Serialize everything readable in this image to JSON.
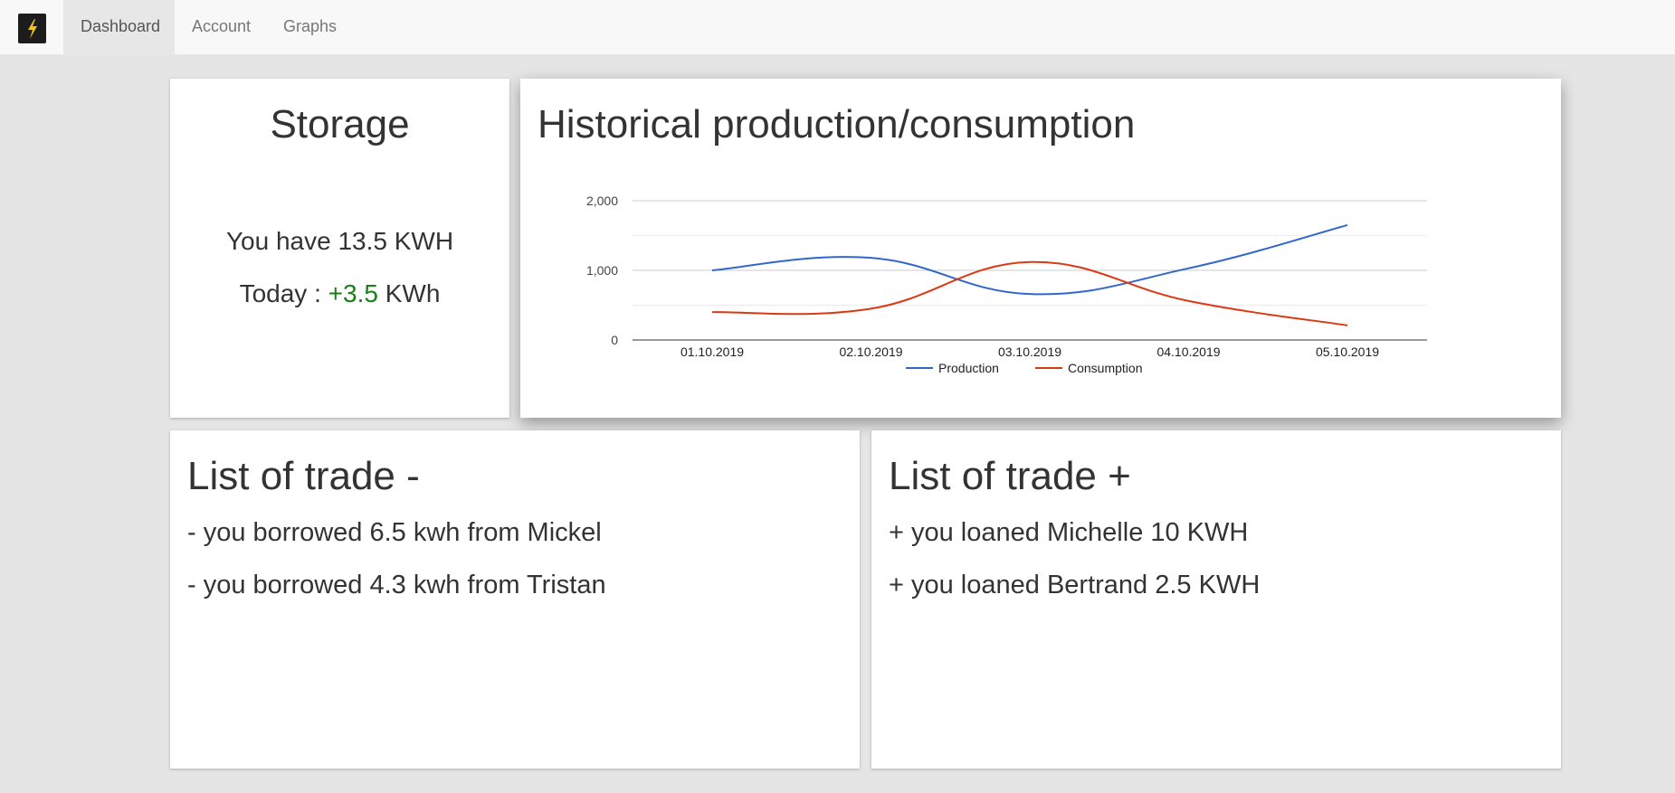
{
  "nav": {
    "brand_icon": "lightning-bolt-icon",
    "items": [
      {
        "label": "Dashboard",
        "active": true
      },
      {
        "label": "Account",
        "active": false
      },
      {
        "label": "Graphs",
        "active": false
      }
    ]
  },
  "storage": {
    "title": "Storage",
    "have_text": "You have 13.5 KWH",
    "today_prefix": "Today : ",
    "today_value": "+3.5",
    "today_unit": " KWh"
  },
  "history": {
    "title": "Historical production/consumption"
  },
  "chart_data": {
    "type": "line",
    "title": "",
    "xlabel": "",
    "ylabel": "",
    "categories": [
      "01.10.2019",
      "02.10.2019",
      "03.10.2019",
      "04.10.2019",
      "05.10.2019"
    ],
    "y_ticks": [
      "0",
      "1,000",
      "2,000"
    ],
    "ylim": [
      0,
      2000
    ],
    "grid": true,
    "legend": "bottom",
    "series": [
      {
        "name": "Production",
        "color": "#3366cc",
        "values": [
          1000,
          1180,
          660,
          1030,
          1650
        ]
      },
      {
        "name": "Consumption",
        "color": "#dc3912",
        "values": [
          400,
          450,
          1120,
          560,
          210
        ]
      }
    ]
  },
  "trade_minus": {
    "title": "List of trade -",
    "items": [
      "- you borrowed 6.5 kwh from Mickel",
      "- you borrowed 4.3 kwh from Tristan"
    ]
  },
  "trade_plus": {
    "title": "List of trade +",
    "items": [
      "+ you loaned Michelle 10 KWH",
      "+ you loaned Bertrand 2.5 KWH"
    ]
  }
}
